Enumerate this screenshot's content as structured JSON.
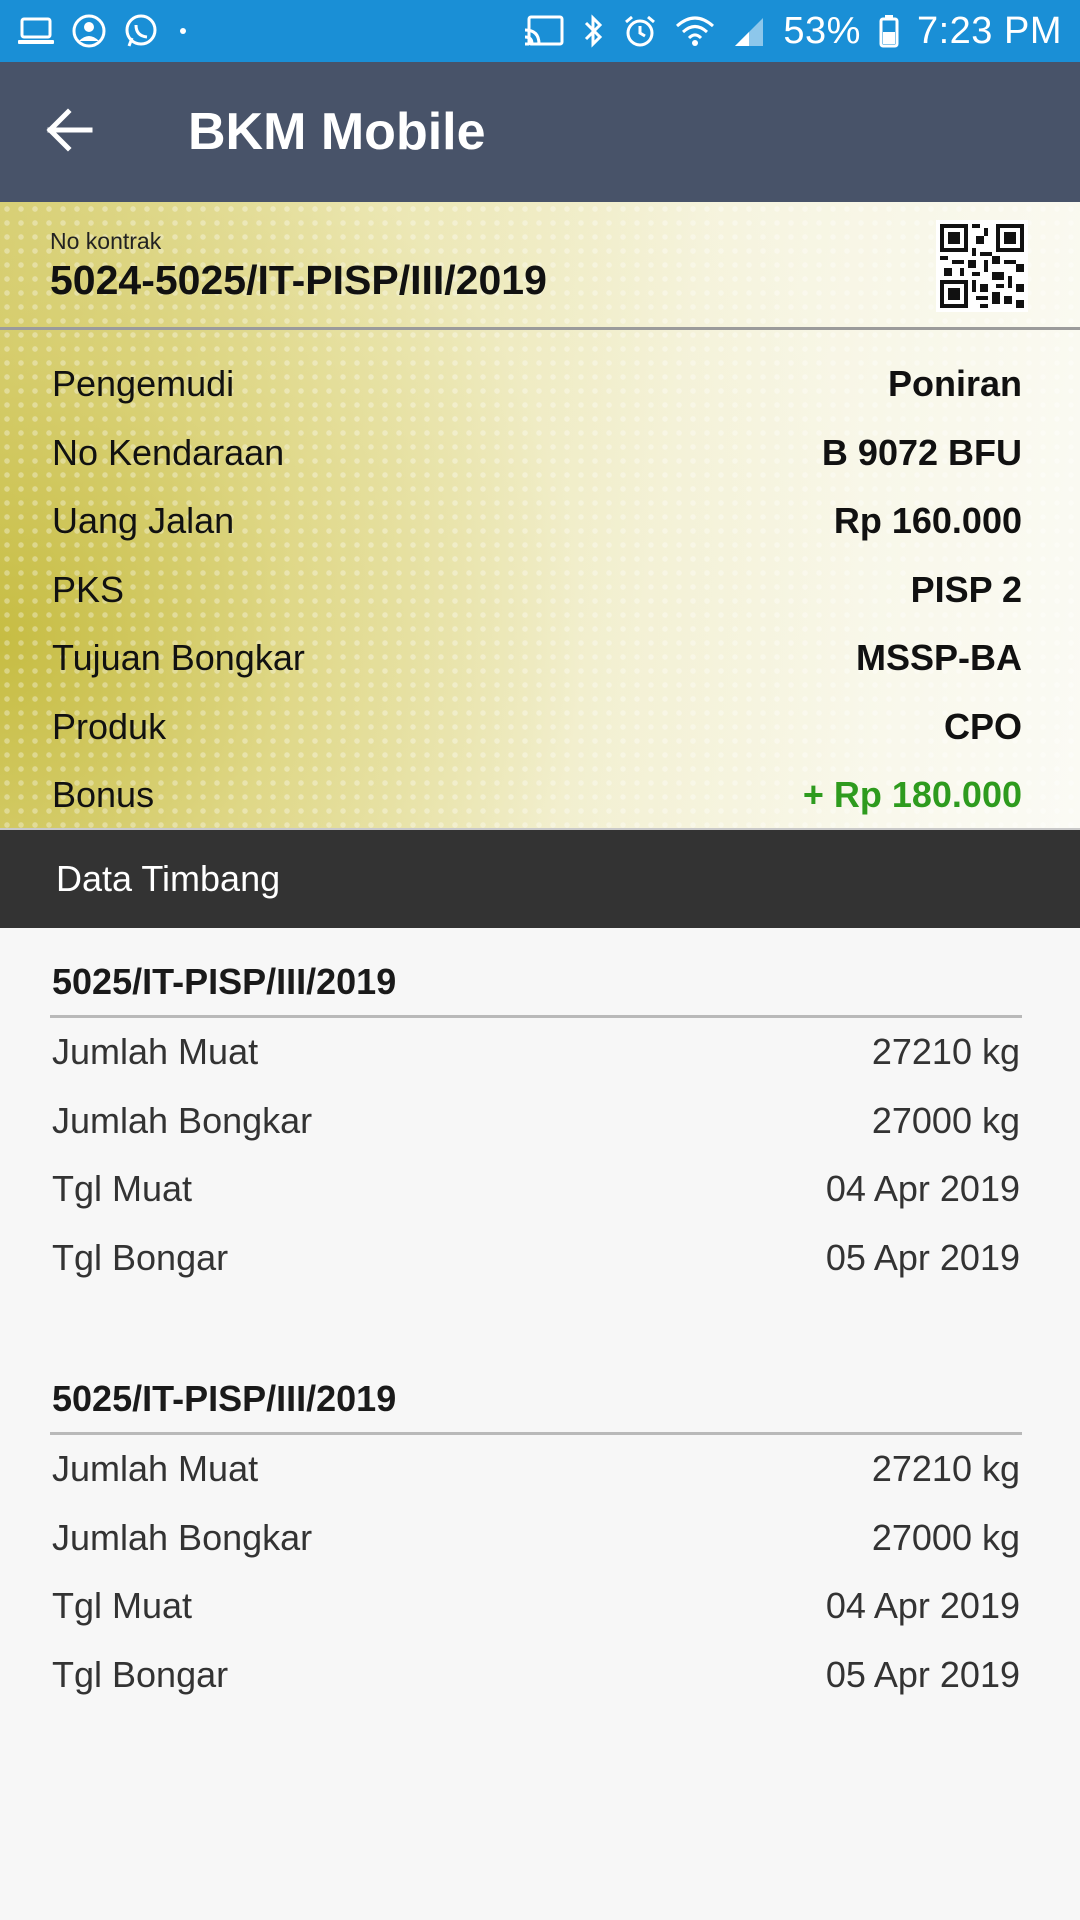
{
  "status_bar": {
    "battery": "53%",
    "time": "7:23 PM",
    "left_icons": [
      "laptop-icon",
      "account-icon",
      "whatsapp-icon",
      "dot-icon"
    ],
    "right_icons": [
      "cast-icon",
      "bluetooth-icon",
      "alarm-icon",
      "wifi-icon",
      "signal-icon",
      "battery-icon"
    ]
  },
  "app_bar": {
    "title": "BKM Mobile",
    "back_icon": "arrow-left-icon"
  },
  "contract": {
    "label": "No kontrak",
    "number": "5024-5025/IT-PISP/III/2019",
    "qr_icon": "qr-code-icon"
  },
  "details": [
    {
      "label": "Pengemudi",
      "value": "Poniran"
    },
    {
      "label": "No Kendaraan",
      "value": "B 9072 BFU"
    },
    {
      "label": "Uang Jalan",
      "value": "Rp 160.000"
    },
    {
      "label": "PKS",
      "value": "PISP 2"
    },
    {
      "label": "Tujuan Bongkar",
      "value": "MSSP-BA"
    },
    {
      "label": "Produk",
      "value": "CPO"
    },
    {
      "label": "Bonus",
      "value": "+ Rp 180.000"
    }
  ],
  "section": {
    "title": "Data Timbang"
  },
  "weighings": [
    {
      "title": "5025/IT-PISP/III/2019",
      "rows": [
        {
          "label": "Jumlah Muat",
          "value": "27210 kg"
        },
        {
          "label": "Jumlah Bongkar",
          "value": "27000 kg"
        },
        {
          "label": "Tgl Muat",
          "value": "04 Apr 2019"
        },
        {
          "label": "Tgl Bongar",
          "value": "05 Apr 2019"
        }
      ]
    },
    {
      "title": "5025/IT-PISP/III/2019",
      "rows": [
        {
          "label": "Jumlah Muat",
          "value": "27210 kg"
        },
        {
          "label": "Jumlah Bongkar",
          "value": "27000 kg"
        },
        {
          "label": "Tgl Muat",
          "value": "04 Apr 2019"
        },
        {
          "label": "Tgl Bongar",
          "value": "05 Apr 2019"
        }
      ]
    }
  ],
  "colors": {
    "status_bar": "#1a8fd6",
    "app_bar": "#485369",
    "section_bar": "#333333",
    "bonus": "#2e9b1e"
  }
}
